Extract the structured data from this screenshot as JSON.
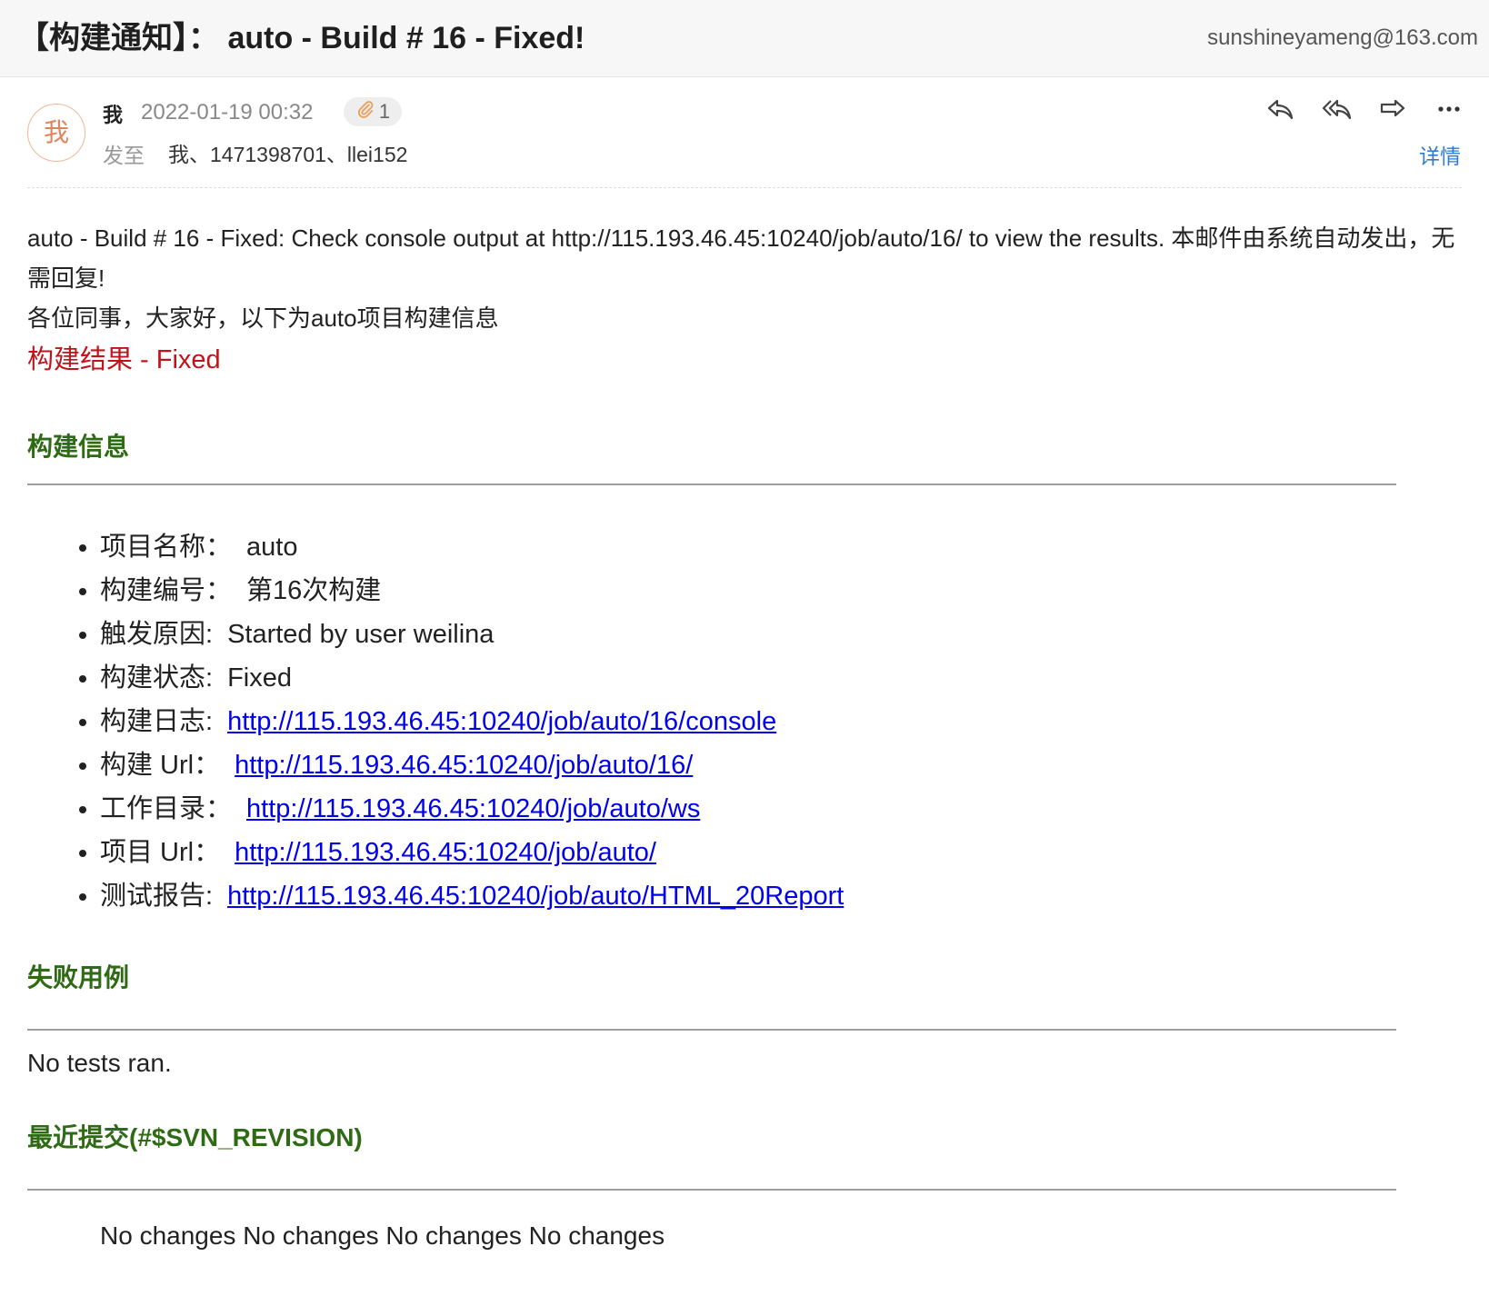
{
  "header": {
    "subject": "【构建通知】： auto - Build # 16 - Fixed!",
    "account": "sunshineyameng@163.com"
  },
  "message": {
    "avatar_char": "我",
    "sender": "我",
    "date": "2022-01-19 00:32",
    "attachment_count": "1",
    "to_label": "发至",
    "recipients": "我、1471398701、llei152",
    "details_label": "详情"
  },
  "icons": {
    "reply": "reply-icon",
    "reply_all": "reply-all-icon",
    "forward": "forward-icon",
    "more": "more-icon",
    "attachment": "paperclip-icon"
  },
  "body": {
    "intro": "auto - Build # 16 - Fixed: Check console output at http://115.193.46.45:10240/job/auto/16/ to view the results. 本邮件由系统自动发出，无需回复!",
    "greeting": "各位同事，大家好，以下为auto项目构建信息",
    "result": "构建结果 - Fixed",
    "build_info_title": "构建信息",
    "build_info": [
      {
        "key": "项目名称：",
        "value": "auto",
        "link": false
      },
      {
        "key": "构建编号：",
        "value": "第16次构建",
        "link": false
      },
      {
        "key": "触发原因:",
        "value": "Started by user weilina",
        "link": false
      },
      {
        "key": "构建状态:",
        "value": "Fixed",
        "link": false
      },
      {
        "key": "构建日志:",
        "value": "http://115.193.46.45:10240/job/auto/16/console",
        "link": true
      },
      {
        "key": "构建 Url：",
        "value": "http://115.193.46.45:10240/job/auto/16/",
        "link": true
      },
      {
        "key": "工作目录：",
        "value": "http://115.193.46.45:10240/job/auto/ws",
        "link": true
      },
      {
        "key": "项目 Url：",
        "value": "http://115.193.46.45:10240/job/auto/",
        "link": true
      },
      {
        "key": "测试报告:",
        "value": "http://115.193.46.45:10240/job/auto/HTML_20Report",
        "link": true
      }
    ],
    "failed_title": "失败用例",
    "failed_text": "No tests ran.",
    "commits_title": "最近提交(#$SVN_REVISION)",
    "commits_text": "No changes No changes No changes No changes"
  },
  "colors": {
    "section_title": "#2e6b14",
    "result": "#c0131b",
    "link": "#0000ee",
    "details": "#2d7bd6"
  }
}
